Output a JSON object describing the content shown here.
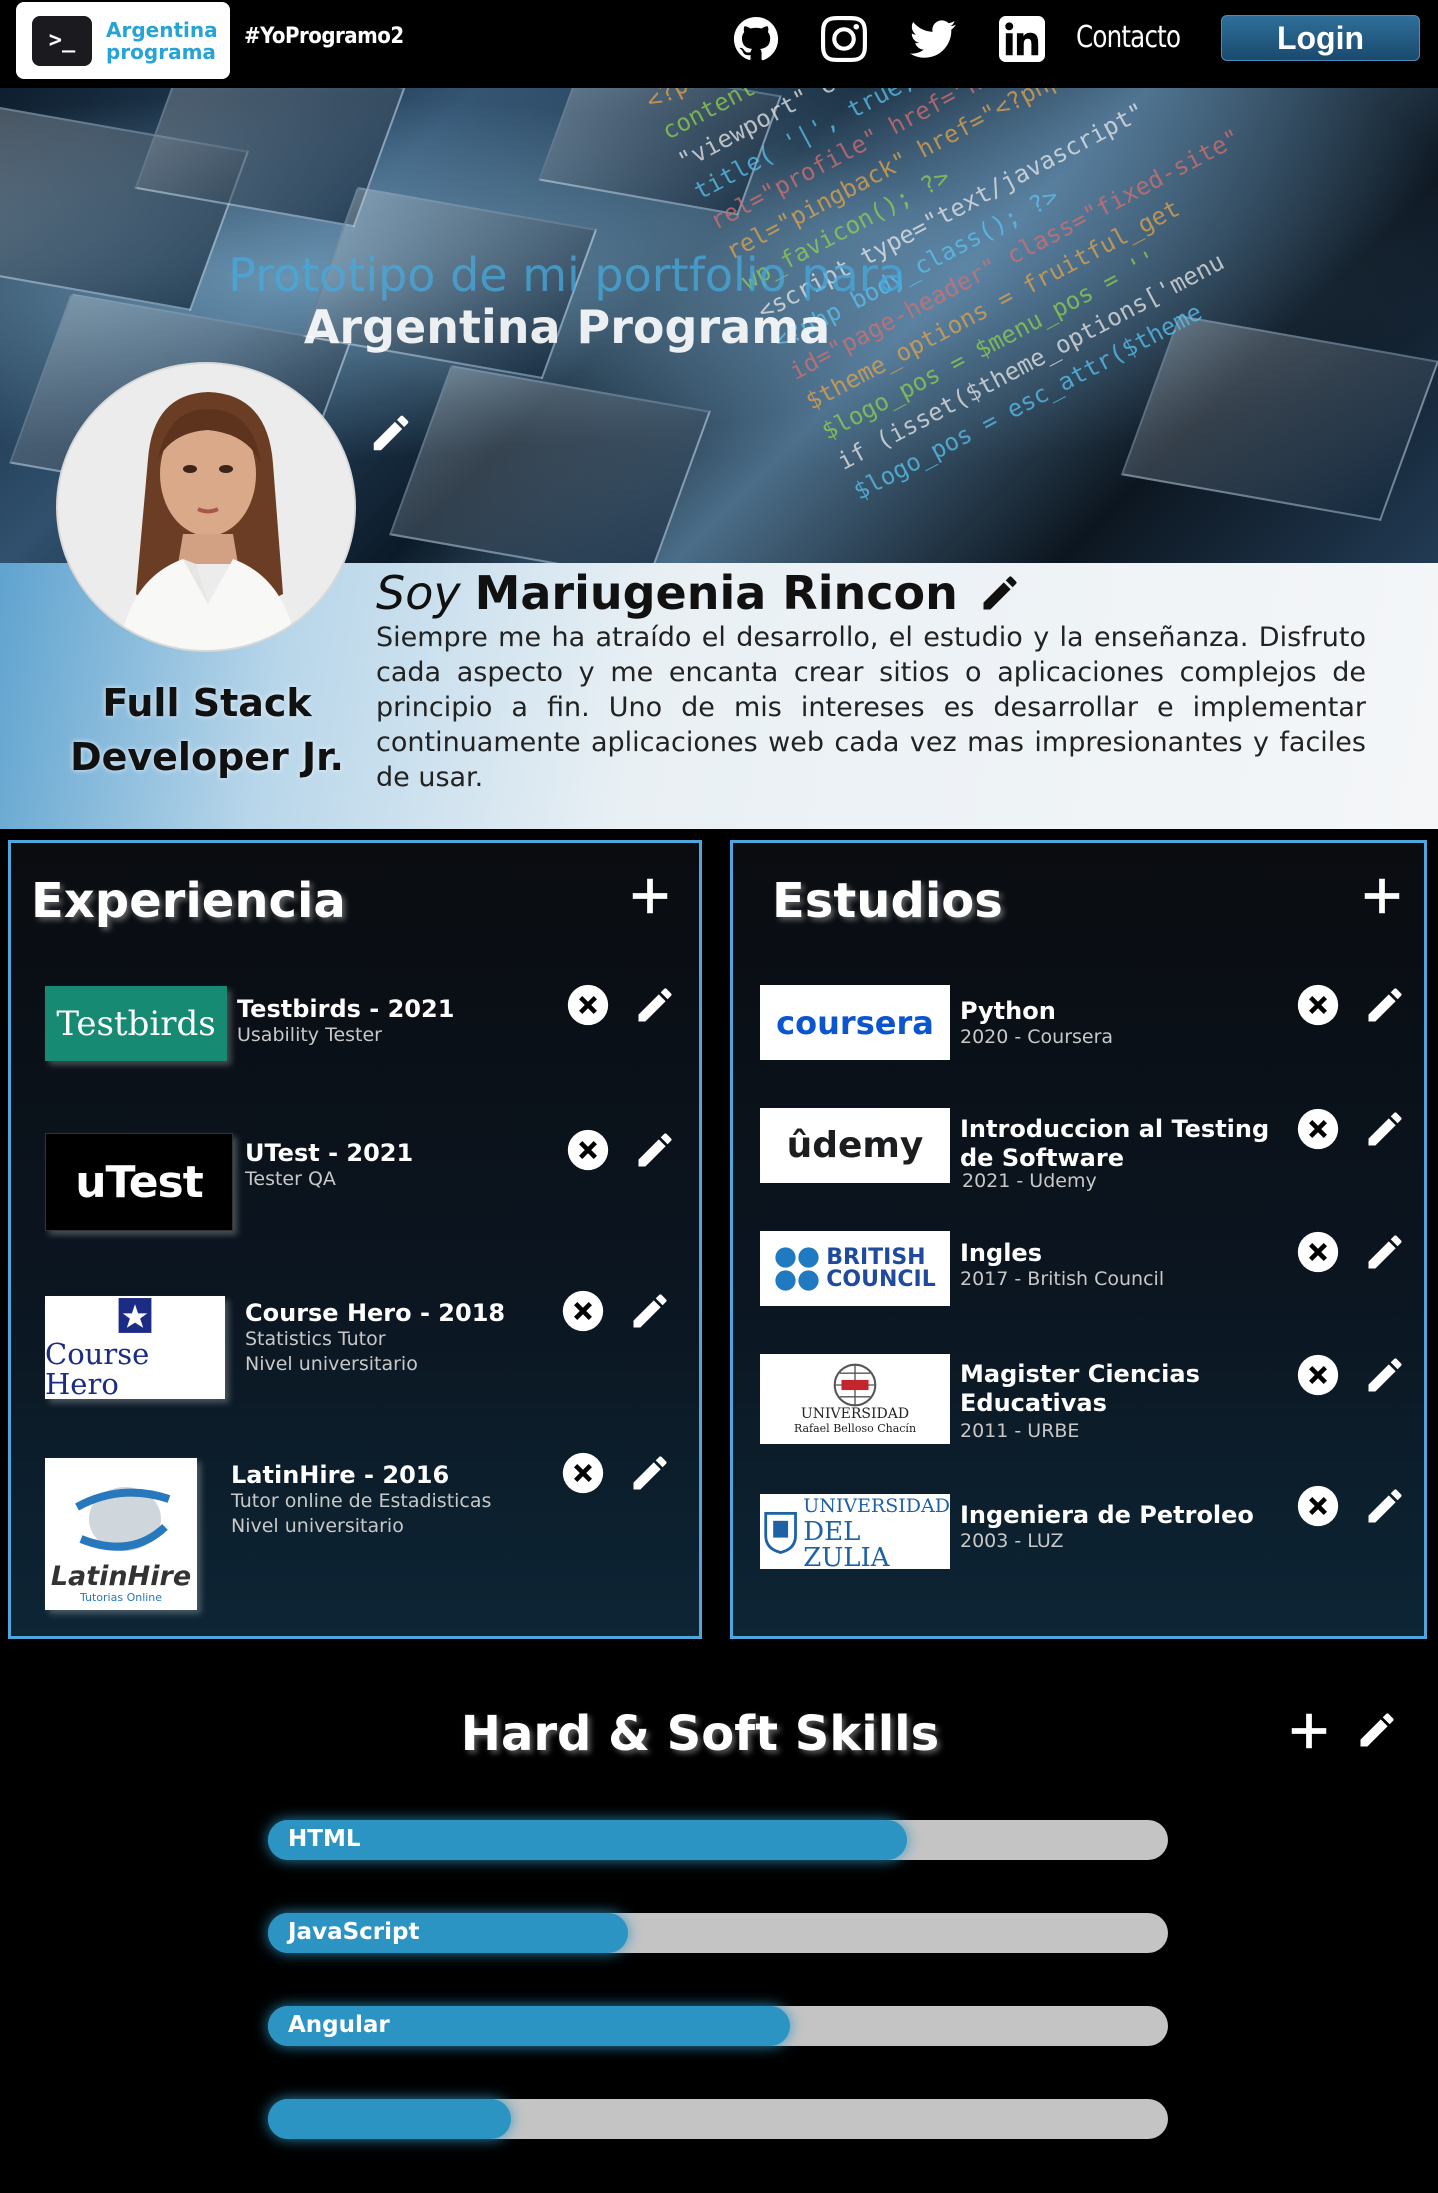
{
  "nav": {
    "brand_line1": "Argentina",
    "brand_line2": "programa",
    "brand_logo_text": ">_",
    "hashtag": "#YoProgramo2",
    "icons": [
      "github-icon",
      "instagram-icon",
      "twitter-icon",
      "linkedin-icon"
    ],
    "contact_label": "Contacto",
    "login_label": "Login"
  },
  "hero": {
    "title_line1": "Prototipo de mi portfolio para",
    "title_line2": "Argentina Programa",
    "code_lines": [
      "<?php bloginfo( 'charset' ); ?>",
      "content=\"width=device-width\"",
      "\"viewport\" content=\"width, 'true'",
      "title( '|', true, 'right' )",
      "rel=\"profile\" href=\"http://gmpg.org/xfn",
      "rel=\"pingback\" href=\"<?php bloginfo( 'pingb",
      "wp_favicon(); ?>",
      "<script type=\"text/javascript\"",
      "<?php body_class(); ?>",
      "id=\"page-header\" class=\"fixed-site\"",
      "$theme_options = fruitful_get",
      "$logo_pos = $menu_pos = ''",
      "if (isset($theme_options['menu",
      "$logo_pos = esc_attr($theme"
    ]
  },
  "profile": {
    "soy": "Soy",
    "name": "Mariugenia Rincon",
    "role_line1": "Full Stack",
    "role_line2": "Developer Jr.",
    "bio": "Siempre me ha atraído el desarrollo, el estudio y la enseñanza. Disfruto cada aspecto y me encanta crear sitios o aplicaciones complejos de principio a fin. Uno de mis intereses es desarrollar e implementar continuamente aplicaciones web cada vez mas impresionantes y faciles de usar."
  },
  "experiencia": {
    "title": "Experiencia",
    "items": [
      {
        "logo": "Testbirds",
        "title": "Testbirds - 2021",
        "line1": "Usability Tester",
        "line2": ""
      },
      {
        "logo": "uTest",
        "title": "UTest - 2021",
        "line1": "Tester QA",
        "line2": ""
      },
      {
        "logo": "Course Hero",
        "title": "Course Hero - 2018",
        "line1": "Statistics Tutor",
        "line2": "Nivel universitario"
      },
      {
        "logo": "LatinHire",
        "logo_sub": "Tutorias Online",
        "title": "LatinHire - 2016",
        "line1": "Tutor online de Estadisticas",
        "line2": "Nivel universitario"
      }
    ]
  },
  "estudios": {
    "title": "Estudios",
    "items": [
      {
        "logo": "coursera",
        "title": "Python",
        "title2": "",
        "line1": "2020 - Coursera"
      },
      {
        "logo": "ûdemy",
        "title": "Introduccion al Testing",
        "title2": "de Software",
        "line1": "2021 - Udemy"
      },
      {
        "logo_l1": "BRITISH",
        "logo_l2": "COUNCIL",
        "title": "Ingles",
        "title2": "",
        "line1": "2017 - British Council"
      },
      {
        "logo_l1": "UNIVERSIDAD",
        "logo_l2": "Rafael Belloso Chacín",
        "title": "Magister Ciencias",
        "title2": "Educativas",
        "line1": "2011 - URBE"
      },
      {
        "logo_l1": "UNIVERSIDAD",
        "logo_l2": "DEL ZULIA",
        "title": "Ingeniera de Petroleo",
        "title2": "",
        "line1": "2003 - LUZ"
      }
    ]
  },
  "skills": {
    "title": "Hard & Soft Skills",
    "items": [
      {
        "label": "HTML",
        "percent": 71
      },
      {
        "label": "JavaScript",
        "percent": 40
      },
      {
        "label": "Angular",
        "percent": 58
      },
      {
        "label": "",
        "percent": 27
      }
    ]
  },
  "colors": {
    "accent": "#2b94c3",
    "panel_border": "#4fa6dc",
    "brand_text": "#27a3d6",
    "login_bg": "#1f557c"
  }
}
